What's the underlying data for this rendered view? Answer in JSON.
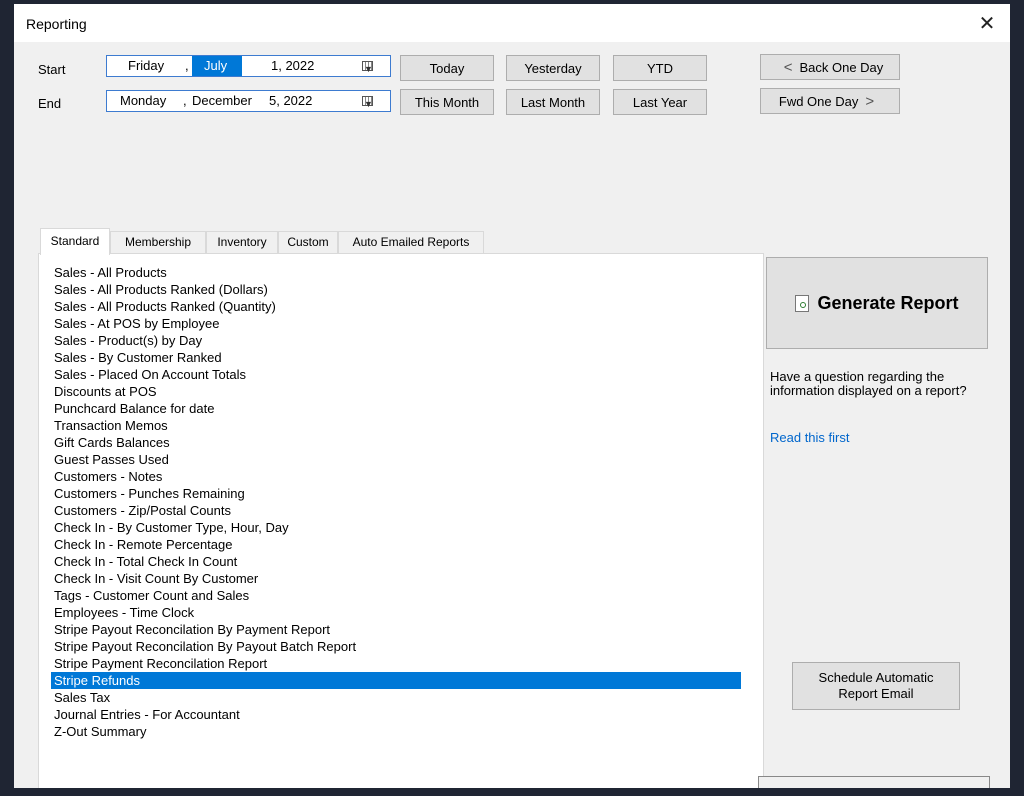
{
  "window": {
    "title": "Reporting",
    "close_glyph": "✕"
  },
  "dates": {
    "start_label": "Start",
    "end_label": "End",
    "start": {
      "weekday": "Friday",
      "sep": ",",
      "month": "July",
      "dayyear": "1, 2022"
    },
    "end": {
      "weekday": "Monday",
      "sep": ",",
      "month": "December",
      "dayyear": "5, 2022"
    }
  },
  "quick_buttons": {
    "today": "Today",
    "yesterday": "Yesterday",
    "ytd": "YTD",
    "this_month": "This Month",
    "last_month": "Last Month",
    "last_year": "Last Year",
    "back_one_day": "Back One Day",
    "fwd_one_day": "Fwd One Day"
  },
  "tabs": [
    "Standard",
    "Membership",
    "Inventory",
    "Custom",
    "Auto Emailed Reports"
  ],
  "active_tab": "Standard",
  "reports": [
    "Sales - All Products",
    "Sales - All Products Ranked (Dollars)",
    "Sales - All Products Ranked (Quantity)",
    "Sales - At POS by Employee",
    "Sales - Product(s) by Day",
    "Sales - By Customer Ranked",
    "Sales - Placed On Account Totals",
    "Discounts at POS",
    "Punchcard Balance for date",
    "Transaction Memos",
    "Gift Cards Balances",
    "Guest Passes Used",
    "Customers - Notes",
    "Customers - Punches Remaining",
    "Customers - Zip/Postal Counts",
    "Check In - By Customer Type, Hour, Day",
    "Check In - Remote Percentage",
    "Check In - Total Check In Count",
    "Check In - Visit Count By Customer",
    "Tags - Customer Count and Sales",
    "Employees - Time Clock",
    "Stripe Payout Reconcilation By Payment Report",
    "Stripe Payout Reconcilation By Payout Batch Report",
    "Stripe Payment Reconcilation Report",
    "Stripe Refunds",
    "Sales Tax",
    "Journal Entries - For Accountant",
    "Z-Out Summary"
  ],
  "selected_report": "Stripe Refunds",
  "actions": {
    "generate": "Generate Report",
    "help_text": "Have a question regarding the information displayed on a report?",
    "help_link": "Read this first",
    "schedule": "Schedule Automatic Report Email"
  },
  "colors": {
    "selection": "#0078d7",
    "link": "#0066cc",
    "window_bg": "#f0f0f0"
  }
}
